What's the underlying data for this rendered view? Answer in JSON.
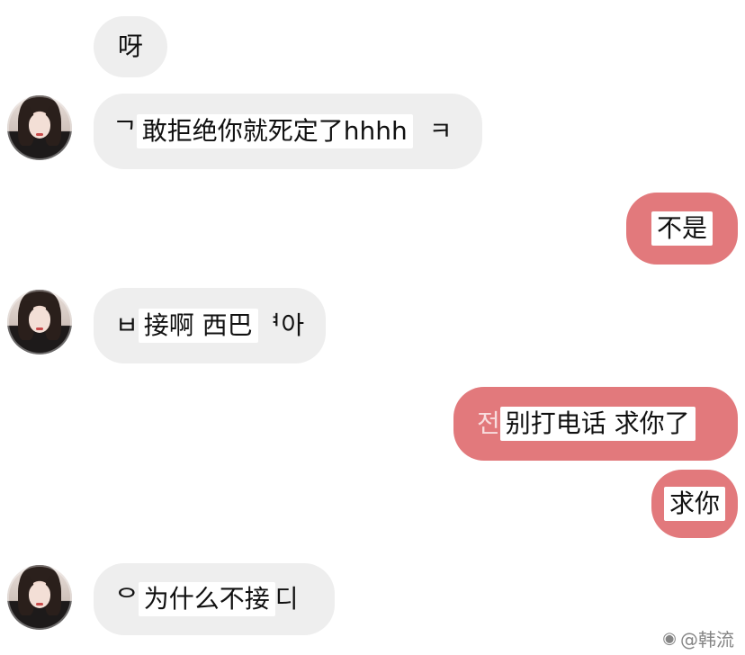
{
  "chat": {
    "messages": [
      {
        "side": "in",
        "text": "呀"
      },
      {
        "side": "in",
        "prefix": "ᄀ",
        "text": "敢拒绝你就死定了hhhh",
        "suffix": "ㅋ"
      },
      {
        "side": "out",
        "text": "不是"
      },
      {
        "side": "in",
        "prefix": "ㅂ",
        "text": "接啊 西巴",
        "suffix": "ᅧ아"
      },
      {
        "side": "out",
        "prefix": "전",
        "text": "别打电话 求你了"
      },
      {
        "side": "out",
        "text": "求你"
      },
      {
        "side": "in",
        "prefix": "ᄋ",
        "text": "为什么不接",
        "suffix": "디"
      }
    ]
  },
  "watermark": {
    "icon": "weibo-icon",
    "text": "@韩流"
  },
  "colors": {
    "incoming_bubble": "#eeeeee",
    "outgoing_bubble": "#e2797c",
    "background": "#ffffff"
  }
}
